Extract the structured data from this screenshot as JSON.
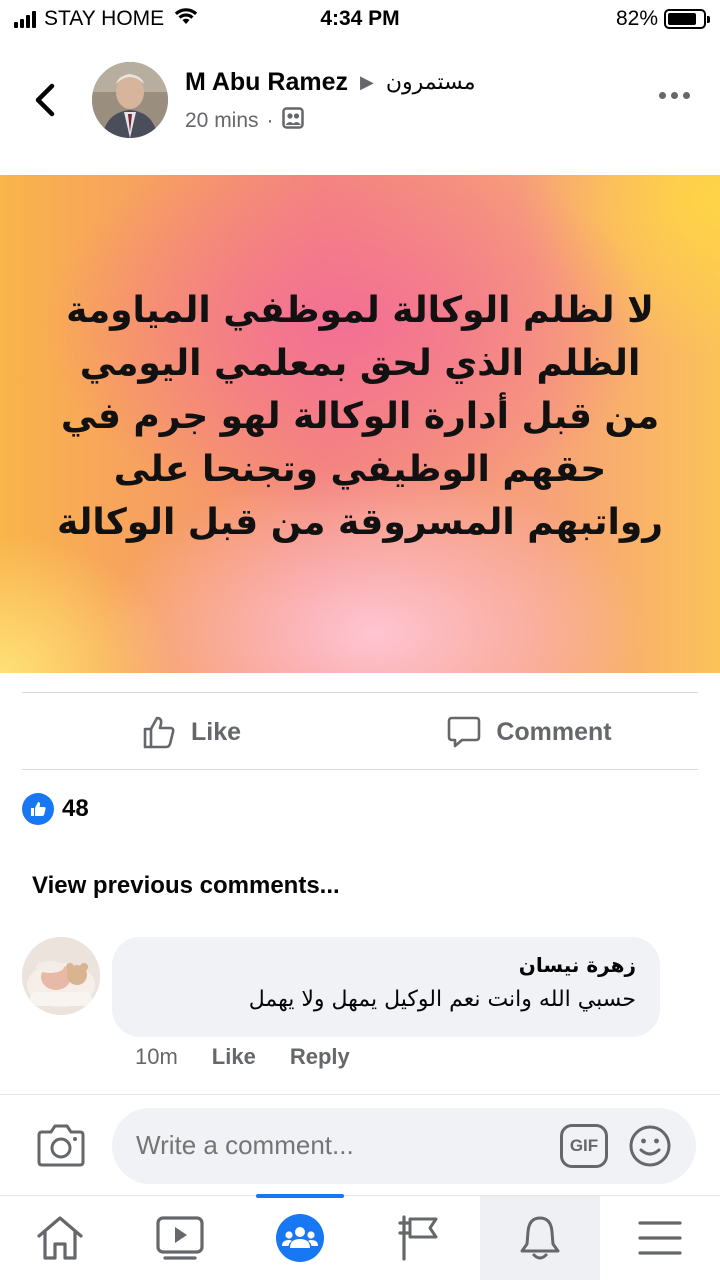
{
  "status_bar": {
    "carrier": "STAY HOME",
    "time": "4:34 PM",
    "battery_percent": "82%",
    "battery_level": 0.82
  },
  "post": {
    "author": "M Abu Ramez",
    "group": "مستمرون",
    "time": "20 mins",
    "privacy_icon": "group-audience-icon",
    "body_text": "لا لظلم الوكالة لموظفي المياومة الظلم الذي لحق بمعلمي اليومي من قبل أدارة الوكالة لهو جرم في حقهم الوظيفي وتجنحا على رواتبهم المسروقة من قبل الوكالة",
    "like_label": "Like",
    "comment_label": "Comment",
    "reaction_count": "48"
  },
  "comments": {
    "view_previous": "View previous comments...",
    "items": [
      {
        "name": "زهرة نيسان",
        "text": "حسبي الله وانت نعم الوكيل يمهل ولا يهمل",
        "time": "10m",
        "like_label": "Like",
        "reply_label": "Reply"
      }
    ]
  },
  "composer": {
    "placeholder": "Write a comment...",
    "gif_label": "GIF"
  },
  "bottom_nav": {
    "items": [
      "home-icon",
      "watch-icon",
      "groups-icon",
      "pages-icon",
      "notifications-icon",
      "menu-icon"
    ],
    "active": "groups-icon"
  },
  "colors": {
    "brand_blue": "#1877f2",
    "secondary_text": "#65676b",
    "bubble_bg": "#f0f2f5"
  }
}
